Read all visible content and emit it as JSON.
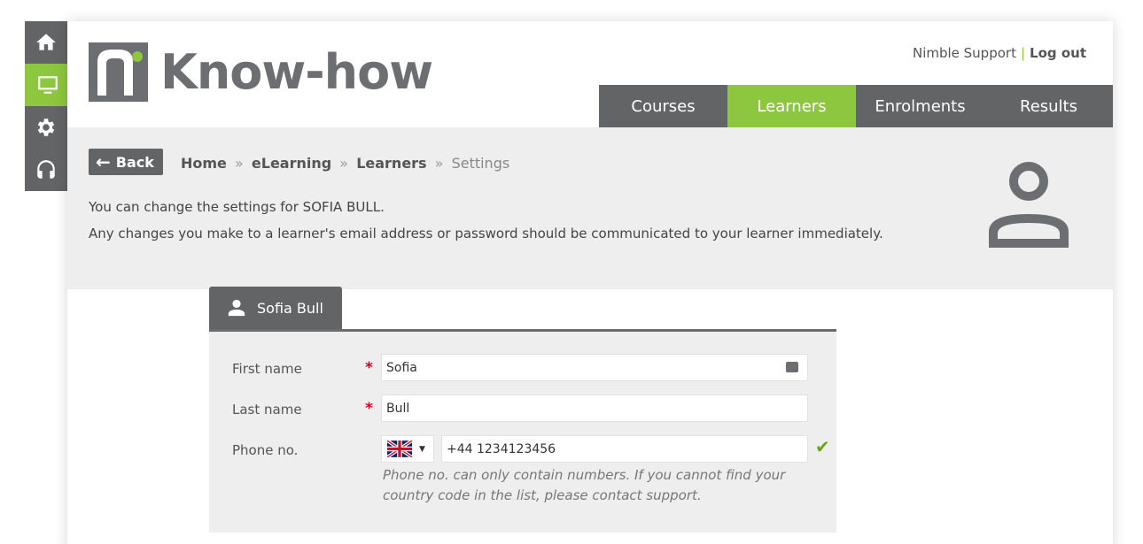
{
  "rail": {
    "items": [
      {
        "icon": "home-icon",
        "active": false
      },
      {
        "icon": "monitor-icon",
        "active": true
      },
      {
        "icon": "gear-icon",
        "active": false
      },
      {
        "icon": "headset-icon",
        "active": false
      }
    ]
  },
  "brand": {
    "name": "Know-how",
    "accent": "#8dc63f",
    "primary": "#636466"
  },
  "toplinks": {
    "support": "Nimble Support",
    "separator": "|",
    "logout": "Log out"
  },
  "nav": {
    "tabs": [
      {
        "label": "Courses",
        "active": false
      },
      {
        "label": "Learners",
        "active": true
      },
      {
        "label": "Enrolments",
        "active": false
      },
      {
        "label": "Results",
        "active": false
      }
    ]
  },
  "hero": {
    "back_label": "Back",
    "breadcrumb": {
      "home": "Home",
      "section": "eLearning",
      "subsection": "Learners",
      "current": "Settings",
      "separator": "»"
    },
    "intro_line1": "You can change the settings for SOFIA BULL.",
    "intro_line2": "Any changes you make to a learner's email address or password should be communicated to your learner immediately."
  },
  "form": {
    "tab_label": "Sofia Bull",
    "first_name": {
      "label": "First name",
      "required": "*",
      "value": "Sofia"
    },
    "last_name": {
      "label": "Last name",
      "required": "*",
      "value": "Bull"
    },
    "phone": {
      "label": "Phone no.",
      "country_flag": "gb-flag-icon",
      "value": "+44 1234123456",
      "hint": "Phone no. can only contain numbers. If you cannot find your country code in the list, please contact support."
    }
  }
}
